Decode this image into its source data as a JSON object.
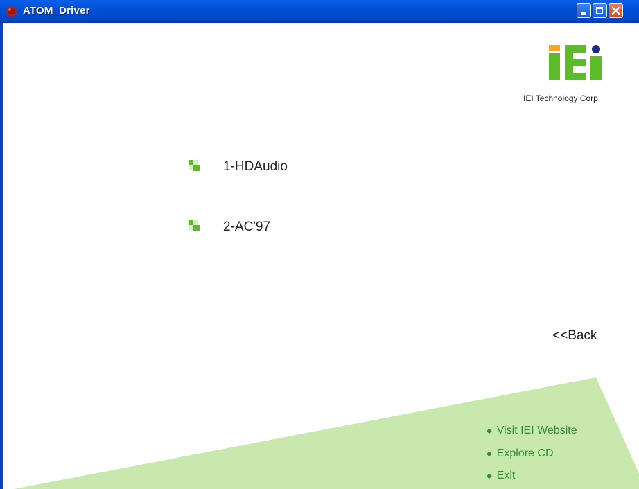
{
  "window": {
    "title": "ATOM_Driver"
  },
  "logo": {
    "caption": "IEI Technology Corp."
  },
  "menu": {
    "items": [
      {
        "label": "1-HDAudio"
      },
      {
        "label": "2-AC'97"
      }
    ]
  },
  "back": {
    "label": "<<Back"
  },
  "footer": {
    "links": [
      {
        "label": "Visit IEI Website"
      },
      {
        "label": "Explore CD"
      },
      {
        "label": "Exit"
      }
    ],
    "bullet": "◆"
  },
  "colors": {
    "titlebar": "#0050d8",
    "accent_green": "#5dbb2a",
    "light_green": "#c9e8ae",
    "link_green": "#2d8f2d",
    "logo_orange": "#f5a623",
    "logo_navy": "#1a2a8a"
  }
}
